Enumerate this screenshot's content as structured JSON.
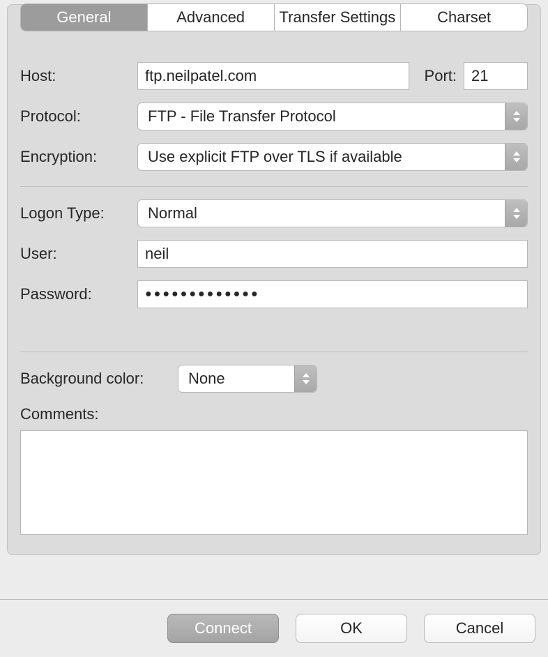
{
  "tabs": {
    "general": "General",
    "advanced": "Advanced",
    "transfer": "Transfer Settings",
    "charset": "Charset"
  },
  "labels": {
    "host": "Host:",
    "port": "Port:",
    "protocol": "Protocol:",
    "encryption": "Encryption:",
    "logon_type": "Logon Type:",
    "user": "User:",
    "password": "Password:",
    "bg_color": "Background color:",
    "comments": "Comments:"
  },
  "values": {
    "host": "ftp.neilpatel.com",
    "port": "21",
    "protocol": "FTP - File Transfer Protocol",
    "encryption": "Use explicit FTP over TLS if available",
    "logon_type": "Normal",
    "user": "neil",
    "password": "●●●●●●●●●●●●●",
    "bg_color": "None",
    "comments": ""
  },
  "buttons": {
    "connect": "Connect",
    "ok": "OK",
    "cancel": "Cancel"
  }
}
